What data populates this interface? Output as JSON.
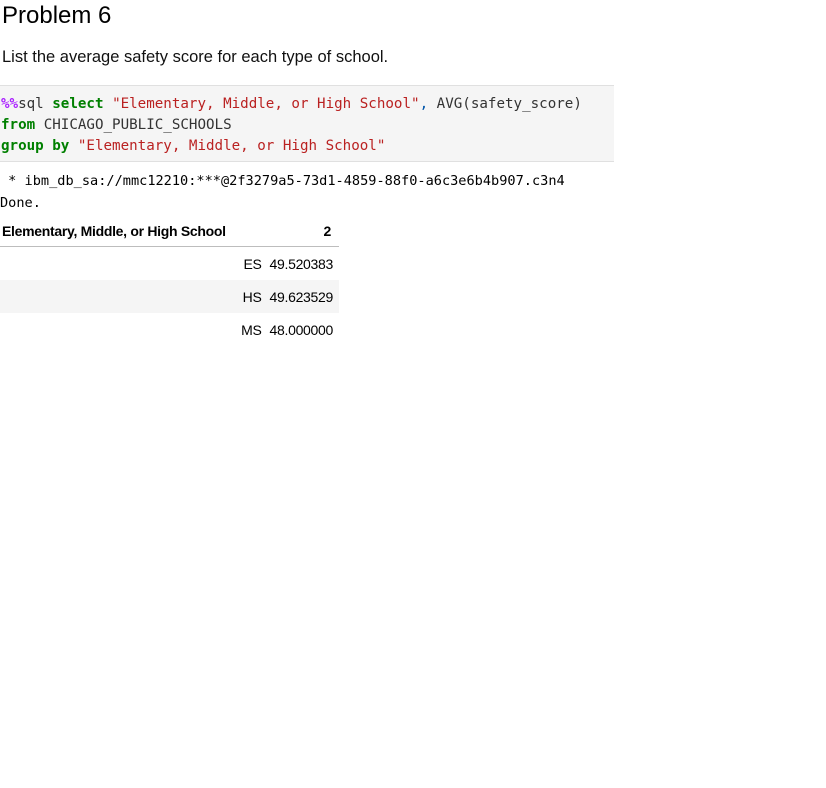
{
  "markdown": {
    "heading": "Problem 6",
    "description": "List the average safety score for each type of school."
  },
  "code_cell": {
    "line1": {
      "magic": "%%",
      "cmd": "sql ",
      "kw_select": "select",
      "str_col": "\"Elementary, Middle, or High School\"",
      "comma": ",",
      "avg_expr": " AVG(safety_score)"
    },
    "line2": {
      "kw_from": "from",
      "table_name": " CHICAGO_PUBLIC_SCHOOLS"
    },
    "line3": {
      "kw_group_by": "group by",
      "str_col": " \"Elementary, Middle, or High School\""
    }
  },
  "output": {
    "connection_line": " * ibm_db_sa://mmc12210:***@2f3279a5-73d1-4859-88f0-a6c3e6b4b907.c3n4",
    "status_line": "Done."
  },
  "result_table": {
    "headers": [
      "Elementary, Middle, or High School",
      "2"
    ],
    "rows": [
      [
        "ES",
        "49.520383"
      ],
      [
        "HS",
        "49.623529"
      ],
      [
        "MS",
        "48.000000"
      ]
    ]
  }
}
